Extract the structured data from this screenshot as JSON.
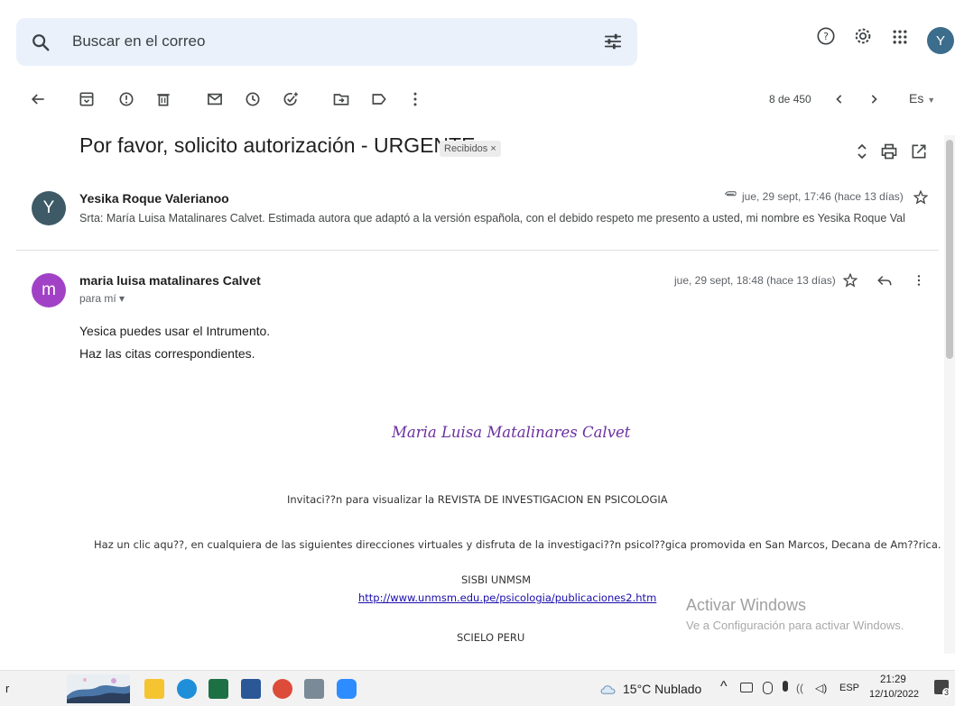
{
  "search": {
    "placeholder": "Buscar en el correo"
  },
  "user": {
    "initial": "Y"
  },
  "toolbar": {
    "count": "8 de 450",
    "lang": "Es"
  },
  "thread": {
    "subject": "Por favor, solicito autorización - URGENTE",
    "label": "Recibidos ×"
  },
  "messages": [
    {
      "initial": "Y",
      "sender": "Yesika Roque Valerianoo",
      "date": "jue, 29 sept, 17:46 (hace 13 días)",
      "snippet": "Srta: María Luisa Matalinares Calvet. Estimada autora que adaptó a la versión española, con el debido respeto me presento a usted, mi nombre es Yesika Roque Val",
      "color": "#3d5a66"
    },
    {
      "initial": "m",
      "sender": "maria luisa matalinares Calvet",
      "date": "jue, 29 sept, 18:48 (hace 13 días)",
      "to": "para mí ▾",
      "color": "#a142c6",
      "body": [
        "Yesica puedes usar el Intrumento.",
        " Haz las citas correspondientes."
      ],
      "signature": "Maria Luisa Matalinares Calvet",
      "invite": "Invitaci??n para visualizar la REVISTA DE INVESTIGACION EN PSICOLOGIA",
      "click": "Haz un clic aqu??,  en cualquiera de las siguientes direcciones virtuales y disfruta de la investigaci??n psicol??gica promovida en San Marcos, Decana de Am??rica.",
      "sisbi": "SISBI UNMSM",
      "sisbi_link": "http://www.unmsm.edu.pe/psicologia/publicaciones2.htm",
      "scielo": "SCIELO PERU"
    }
  ],
  "watermark": {
    "line1": "Activar Windows",
    "line2": "Ve a Configuración para activar Windows."
  },
  "taskbar": {
    "left_text": "r",
    "weather": "15°C  Nublado",
    "lang": "ESP",
    "time": "21:29",
    "date": "12/10/2022",
    "notifications": "3"
  }
}
